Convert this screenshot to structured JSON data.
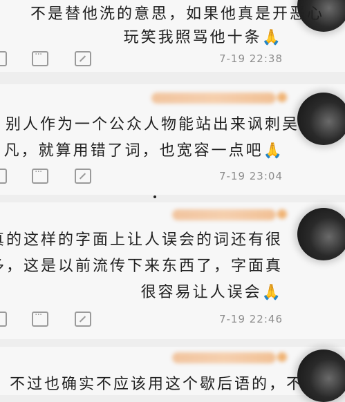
{
  "comments": [
    {
      "lines": [
        "不是替他洗的意思，如果他真是开恶心",
        "玩笑我照骂他十条🙏"
      ],
      "timestamp": "7-19 22:38"
    },
    {
      "lines": [
        "别人作为一个公众人物能站出来讽刺吴",
        "凡，就算用错了词，也宽容一点吧🙏"
      ],
      "timestamp": "7-19 23:04"
    },
    {
      "lines": [
        "真的这样的字面上让人误会的词还有很",
        "多，这是以前流传下来东西了，字面真",
        "很容易让人误会🙏"
      ],
      "timestamp": "7-19 22:46"
    },
    {
      "lines": [
        "不过也确实不应该用这个歇后语的，不"
      ],
      "timestamp": ""
    }
  ],
  "icons": [
    "like-icon",
    "comment-icon",
    "share-icon"
  ]
}
